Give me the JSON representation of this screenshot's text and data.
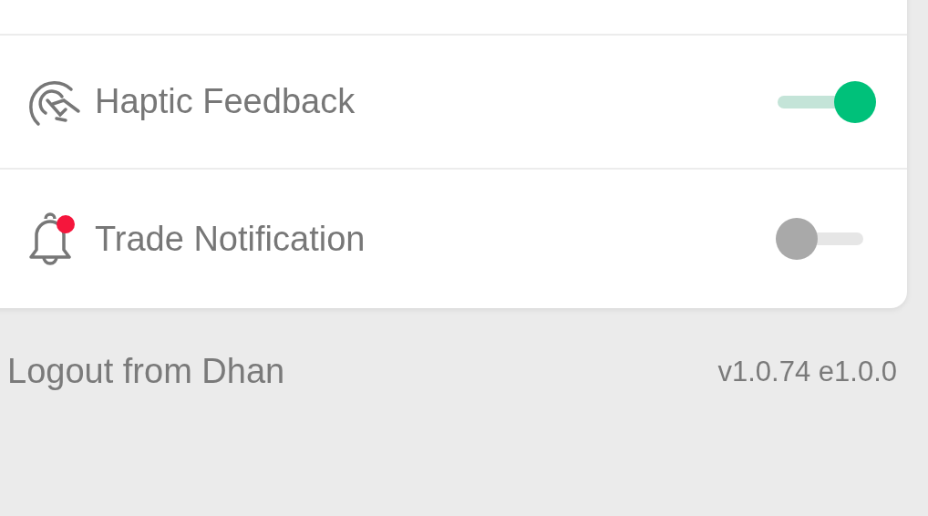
{
  "settings": [
    {
      "kind": "toggle",
      "label": "Haptic Feedback",
      "on": true
    },
    {
      "kind": "toggle",
      "label": "Trade Notification",
      "on": false,
      "badge": true
    }
  ],
  "footer": {
    "logout": "Logout from Dhan",
    "version": "v1.0.74 e1.0.0"
  }
}
